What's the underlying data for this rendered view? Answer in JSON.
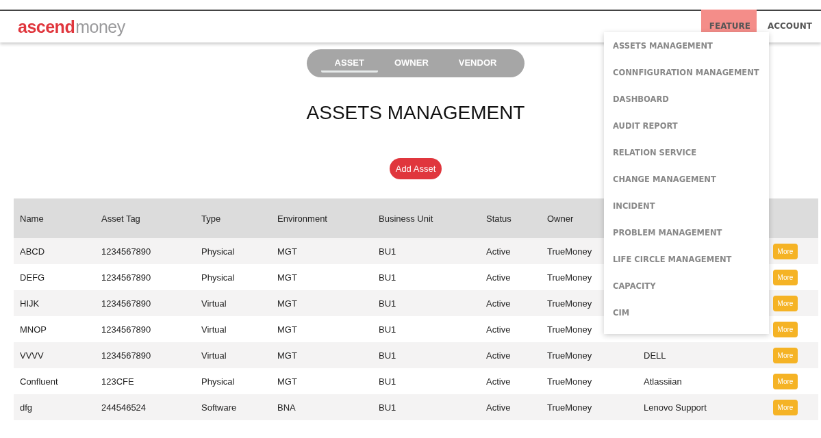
{
  "navbar": {
    "logo": {
      "brand": "ascend",
      "suffix": "money"
    },
    "items": [
      {
        "label": "FEATURE",
        "selected": true
      },
      {
        "label": "ACCOUNT",
        "selected": false
      }
    ]
  },
  "feature_menu": [
    "ASSETS MANAGEMENT",
    "CONNFIGURATION MANAGEMENT",
    "DASHBOARD",
    "AUDIT REPORT",
    "RELATION SERVICE",
    "CHANGE MANAGEMENT",
    "INCIDENT",
    "PROBLEM MANAGEMENT",
    "LIFE CIRCLE MANAGEMENT",
    "CAPACITY",
    "CIM"
  ],
  "tabs": [
    {
      "label": "ASSET",
      "selected": true
    },
    {
      "label": "OWNER",
      "selected": false
    },
    {
      "label": "VENDOR",
      "selected": false
    }
  ],
  "title": "ASSETS MANAGEMENT",
  "add_button": "Add Asset",
  "table": {
    "columns": [
      "Name",
      "Asset Tag",
      "Type",
      "Environment",
      "Business Unit",
      "Status",
      "Owner"
    ],
    "rows": [
      {
        "cells": [
          "ABCD",
          "1234567890",
          "Physical",
          "MGT",
          "BU1",
          "Active",
          "TrueMoney"
        ],
        "action": "More"
      },
      {
        "cells": [
          "DEFG",
          "1234567890",
          "Physical",
          "MGT",
          "BU1",
          "Active",
          "TrueMoney"
        ],
        "action": "More"
      },
      {
        "cells": [
          "HIJK",
          "1234567890",
          "Virtual",
          "MGT",
          "BU1",
          "Active",
          "TrueMoney"
        ],
        "action": "More"
      },
      {
        "cells": [
          "MNOP",
          "1234567890",
          "Virtual",
          "MGT",
          "BU1",
          "Active",
          "TrueMoney"
        ],
        "action": "More"
      },
      {
        "cells": [
          "VVVV",
          "1234567890",
          "Virtual",
          "MGT",
          "BU1",
          "Active",
          "TrueMoney"
        ],
        "vendor": "DELL",
        "action": "More"
      },
      {
        "cells": [
          "Confluent",
          "123CFE",
          "Physical",
          "MGT",
          "BU1",
          "Active",
          "TrueMoney"
        ],
        "vendor": "Atlassiian",
        "action": "More"
      },
      {
        "cells": [
          "dfg",
          "244546524",
          "Software",
          "BNA",
          "BU1",
          "Active",
          "TrueMoney"
        ],
        "vendor": "Lenovo Support",
        "action": "More"
      }
    ]
  }
}
